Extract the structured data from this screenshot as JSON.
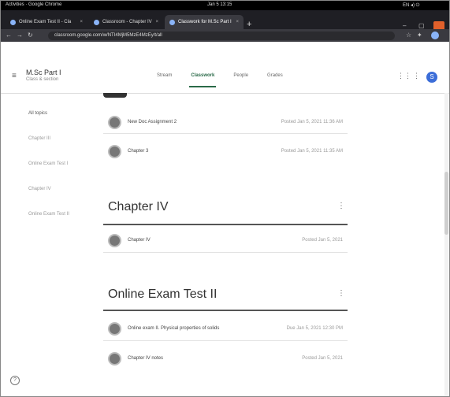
{
  "os": {
    "left": "Activities · Google Chrome",
    "clock": "Jan 5 13:15",
    "right": "EN ◂) ⏻"
  },
  "tabs": [
    {
      "label": "Online Exam Test II - Cla"
    },
    {
      "label": "Classroom - Chapter IV"
    },
    {
      "label": "Classwork for M.Sc Part I"
    }
  ],
  "newtab": "+",
  "address": {
    "url": "classroom.google.com/w/NTI4MjM5MzE4MzEy/t/all"
  },
  "header": {
    "menu": "≡",
    "class_title": "M.Sc Part I",
    "class_subtitle": "Class & section",
    "apps": "⋮⋮",
    "more": "⋮",
    "avatar": "S"
  },
  "class_tabs": [
    "Stream",
    "Classwork",
    "People",
    "Grades"
  ],
  "sidebar": [
    "All topics",
    "Chapter III",
    "Online Exam Test I",
    "Chapter IV",
    "Online Exam Test II"
  ],
  "sections": [
    {
      "items": [
        {
          "icon": "assignment-icon",
          "label": "New Doc Assignment 2",
          "date": "Posted Jan 5, 2021 11:36 AM"
        },
        {
          "icon": "material-icon",
          "label": "Chapter 3",
          "date": "Posted Jan 5, 2021 11:35 AM"
        }
      ]
    },
    {
      "title": "Chapter IV",
      "items": [
        {
          "icon": "material-icon",
          "label": "Chapter IV",
          "date": "Posted Jan 5, 2021"
        }
      ]
    },
    {
      "title": "Online Exam Test II",
      "items": [
        {
          "icon": "assignment-icon",
          "label": "Online exam II. Physical properties of solids",
          "date": "Due Jan 5, 2021 12:30 PM"
        },
        {
          "icon": "material-icon",
          "label": "Chapter IV notes",
          "date": "Posted Jan 5, 2021"
        }
      ]
    }
  ],
  "kebab": "⋮",
  "help": "?"
}
